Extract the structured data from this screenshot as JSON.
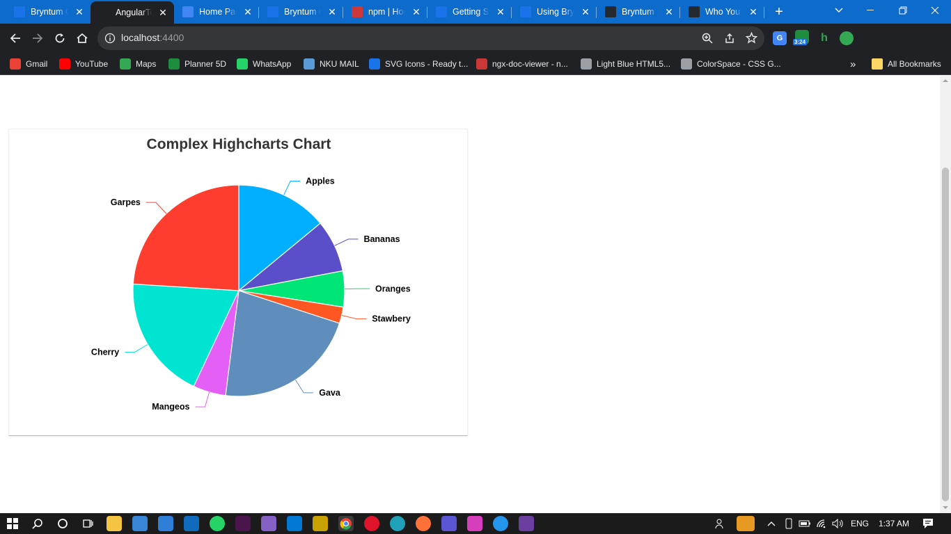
{
  "browser": {
    "tabs": [
      {
        "title": "Bryntum Grid",
        "icon": "bryntum-icon",
        "color": "#1a73e8"
      },
      {
        "title": "AngularTest",
        "icon": "angular-icon",
        "color": "#202124"
      },
      {
        "title": "Home Page",
        "icon": "document-icon",
        "color": "#4285f4"
      },
      {
        "title": "Bryntum Grid",
        "icon": "bryntum-icon",
        "color": "#1a73e8"
      },
      {
        "title": "npm | Home",
        "icon": "npm-icon",
        "color": "#cb3837"
      },
      {
        "title": "Getting Started",
        "icon": "bryntum-icon",
        "color": "#1a73e8"
      },
      {
        "title": "Using Bryntum",
        "icon": "bryntum-icon",
        "color": "#1a73e8"
      },
      {
        "title": "Bryntum",
        "icon": "github-icon",
        "color": "#24292f"
      },
      {
        "title": "Who You",
        "icon": "github-icon",
        "color": "#24292f"
      }
    ],
    "new_tab_label": "+",
    "url_host": "localhost",
    "url_port": ":4400",
    "extension_badge": "3:24",
    "bookmarks": [
      {
        "label": "Gmail",
        "icon": "gmail-icon",
        "color": "#ea4335"
      },
      {
        "label": "YouTube",
        "icon": "youtube-icon",
        "color": "#ff0000"
      },
      {
        "label": "Maps",
        "icon": "maps-icon",
        "color": "#34a853"
      },
      {
        "label": "Planner 5D",
        "icon": "planner5d-icon",
        "color": "#1e8e3e"
      },
      {
        "label": "WhatsApp",
        "icon": "whatsapp-icon",
        "color": "#25d366"
      },
      {
        "label": "NKU MAIL",
        "icon": "mail-icon",
        "color": "#5b9bd5"
      },
      {
        "label": "SVG Icons - Ready t...",
        "icon": "globe-icon",
        "color": "#1a73e8"
      },
      {
        "label": "ngx-doc-viewer - n...",
        "icon": "npm-icon",
        "color": "#cb3837"
      },
      {
        "label": "Light Blue HTML5...",
        "icon": "globe-icon",
        "color": "#9aa0a6"
      },
      {
        "label": "ColorSpace - CSS G...",
        "icon": "globe-icon",
        "color": "#9aa0a6"
      }
    ],
    "bookmarks_overflow": "»",
    "all_bookmarks": "All Bookmarks"
  },
  "chart_data": {
    "type": "pie",
    "title": "Complex Highcharts Chart",
    "categories": [
      "Apples",
      "Bananas",
      "Oranges",
      "Stawbery",
      "Gava",
      "Mangeos",
      "Cherry",
      "Garpes"
    ],
    "values": [
      14,
      8,
      5.5,
      2.5,
      22,
      5,
      19,
      24
    ],
    "colors": [
      "#00b0ff",
      "#5b4fc9",
      "#00e676",
      "#ff5722",
      "#5f8dbc",
      "#e35ff5",
      "#00e5d1",
      "#ff3d2e"
    ]
  },
  "taskbar": {
    "language": "ENG",
    "time": "1:37 AM"
  }
}
